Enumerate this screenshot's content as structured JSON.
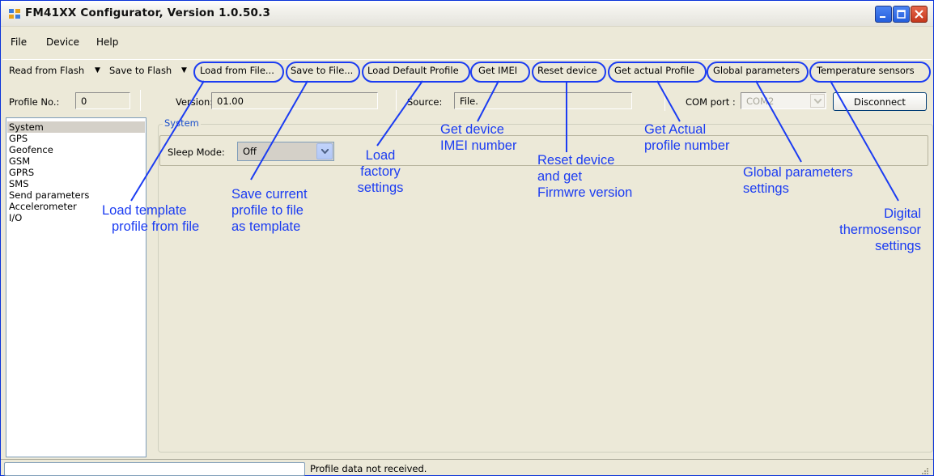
{
  "window": {
    "title": "FM41XX Configurator, Version 1.0.50.3"
  },
  "menu": {
    "file": "File",
    "device": "Device",
    "help": "Help"
  },
  "toolbar": {
    "read_from_flash": "Read from Flash",
    "save_to_flash": "Save to Flash",
    "load_from_file": "Load from File...",
    "save_to_file": "Save to File...",
    "load_default_profile": "Load Default Profile",
    "get_imei": "Get IMEI",
    "reset_device": "Reset device",
    "get_actual_profile": "Get actual Profile",
    "global_parameters": "Global parameters",
    "temperature_sensors": "Temperature sensors"
  },
  "info": {
    "profile_no_label": "Profile No.:",
    "profile_no_value": "0",
    "version_label": "Version:",
    "version_value": "01.00",
    "source_label": "Source:",
    "source_value": "File.",
    "com_port_label": "COM port :",
    "com_port_value": "COM2",
    "disconnect_label": "Disconnect"
  },
  "sidebar": {
    "items": [
      "System",
      "GPS",
      "Geofence",
      "GSM",
      "GPRS",
      "SMS",
      "Send parameters",
      "Accelerometer",
      "I/O"
    ]
  },
  "system_group": {
    "title": "System",
    "sleep_mode_label": "Sleep Mode:",
    "sleep_mode_value": "Off"
  },
  "status": {
    "text": "Profile data not received."
  },
  "annotations": {
    "load_template": [
      "Load template",
      "profile from file"
    ],
    "save_current": [
      "Save current",
      "profile to file",
      "as template"
    ],
    "load_factory": [
      "Load",
      "factory",
      "settings"
    ],
    "get_imei": [
      "Get device",
      "IMEI number"
    ],
    "reset_device": [
      "Reset device",
      "and get",
      "Firmwre version"
    ],
    "get_actual": [
      "Get Actual",
      "profile number"
    ],
    "global_params": [
      "Global parameters",
      "settings"
    ],
    "thermo": [
      "Digital",
      "thermosensor",
      "settings"
    ]
  },
  "colors": {
    "annotation": "#1B3CF2",
    "window_bg": "#ECE9D8",
    "selection": "#D4D0C8",
    "group_title": "#1A4FCB"
  }
}
